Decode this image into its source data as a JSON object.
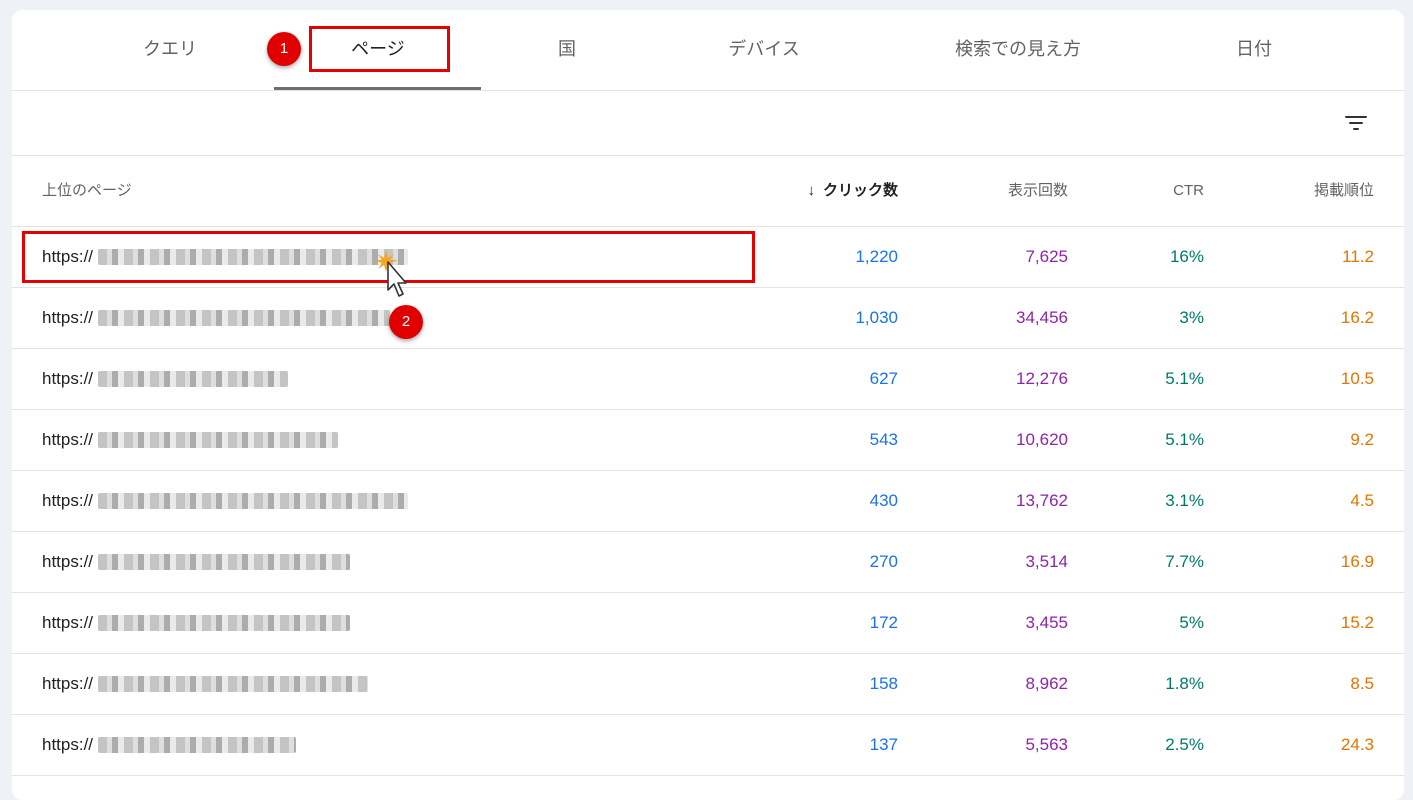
{
  "tabs": [
    {
      "label": "クエリ",
      "active": false
    },
    {
      "label": "ページ",
      "active": true
    },
    {
      "label": "国",
      "active": false
    },
    {
      "label": "デバイス",
      "active": false
    },
    {
      "label": "検索での見え方",
      "active": false
    },
    {
      "label": "日付",
      "active": false
    }
  ],
  "toolbar": {
    "filter_icon": "filter-icon"
  },
  "table": {
    "headers": {
      "page": "上位のページ",
      "clicks": "クリック数",
      "impressions": "表示回数",
      "ctr": "CTR",
      "position": "掲載順位"
    },
    "sort_indicator": "↓",
    "rows": [
      {
        "url": "https://",
        "clicks": "1,220",
        "impressions": "7,625",
        "ctr": "16%",
        "position": "11.2"
      },
      {
        "url": "https://",
        "clicks": "1,030",
        "impressions": "34,456",
        "ctr": "3%",
        "position": "16.2"
      },
      {
        "url": "https://",
        "clicks": "627",
        "impressions": "12,276",
        "ctr": "5.1%",
        "position": "10.5"
      },
      {
        "url": "https://",
        "clicks": "543",
        "impressions": "10,620",
        "ctr": "5.1%",
        "position": "9.2"
      },
      {
        "url": "https://",
        "clicks": "430",
        "impressions": "13,762",
        "ctr": "3.1%",
        "position": "4.5"
      },
      {
        "url": "https://",
        "clicks": "270",
        "impressions": "3,514",
        "ctr": "7.7%",
        "position": "16.9"
      },
      {
        "url": "https://",
        "clicks": "172",
        "impressions": "3,455",
        "ctr": "5%",
        "position": "15.2"
      },
      {
        "url": "https://",
        "clicks": "158",
        "impressions": "8,962",
        "ctr": "1.8%",
        "position": "8.5"
      },
      {
        "url": "https://",
        "clicks": "137",
        "impressions": "5,563",
        "ctr": "2.5%",
        "position": "24.3"
      }
    ]
  },
  "annotations": {
    "badge1": "1",
    "badge2": "2"
  },
  "colors": {
    "clicks": "#1a73e8",
    "impressions": "#8e24aa",
    "ctr": "#00796b",
    "position": "#e37400",
    "annotation": "#e60000"
  }
}
